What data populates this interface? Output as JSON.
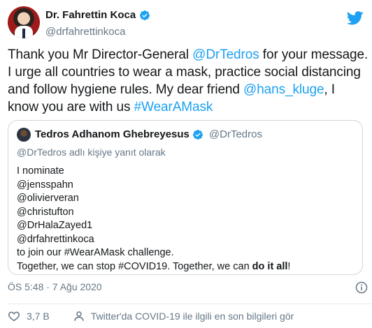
{
  "tweet": {
    "author": {
      "display_name": "Dr. Fahrettin Koca",
      "handle": "@drfahrettinkoca",
      "verified": true,
      "avatar_icon": "profile-photo"
    },
    "text": {
      "part1": "Thank you Mr Director-General ",
      "mention1": "@DrTedros",
      "part2": " for your message. I urge all countries to wear a mask, practice social distancing and follow hygiene rules. My dear friend ",
      "mention2": "@hans_kluge",
      "part3": ", I know you are with us ",
      "hashtag": "#WearAMask"
    },
    "timestamp": "ÖS 5:48 · 7 Ağu 2020",
    "like_count": "3,7 B",
    "covid_info": "Twitter'da COVID-19 ile ilgili en son bilgileri gör"
  },
  "quoted_tweet": {
    "display_name": "Tedros Adhanom Ghebreyesus",
    "handle": "@DrTedros",
    "reply_context": "@DrTedros adlı kişiye yanıt olarak",
    "lines": [
      "I nominate",
      "@jensspahn",
      "@olivierveran",
      "@christufton",
      "@DrHalaZayed1",
      "@drfahrettinkoca",
      "to join our #WearAMask challenge."
    ],
    "last_line_start": "Together, we can stop #COVID19. Together, we can ",
    "last_line_bold": "do it all",
    "last_line_end": "!"
  },
  "colors": {
    "link": "#1da1f2",
    "secondary_text": "#657786",
    "primary_text": "#14171a",
    "border": "#ccd6dd"
  },
  "icons": [
    "verified-badge-icon",
    "twitter-bird-icon",
    "info-icon",
    "heart-icon",
    "person-icon"
  ]
}
